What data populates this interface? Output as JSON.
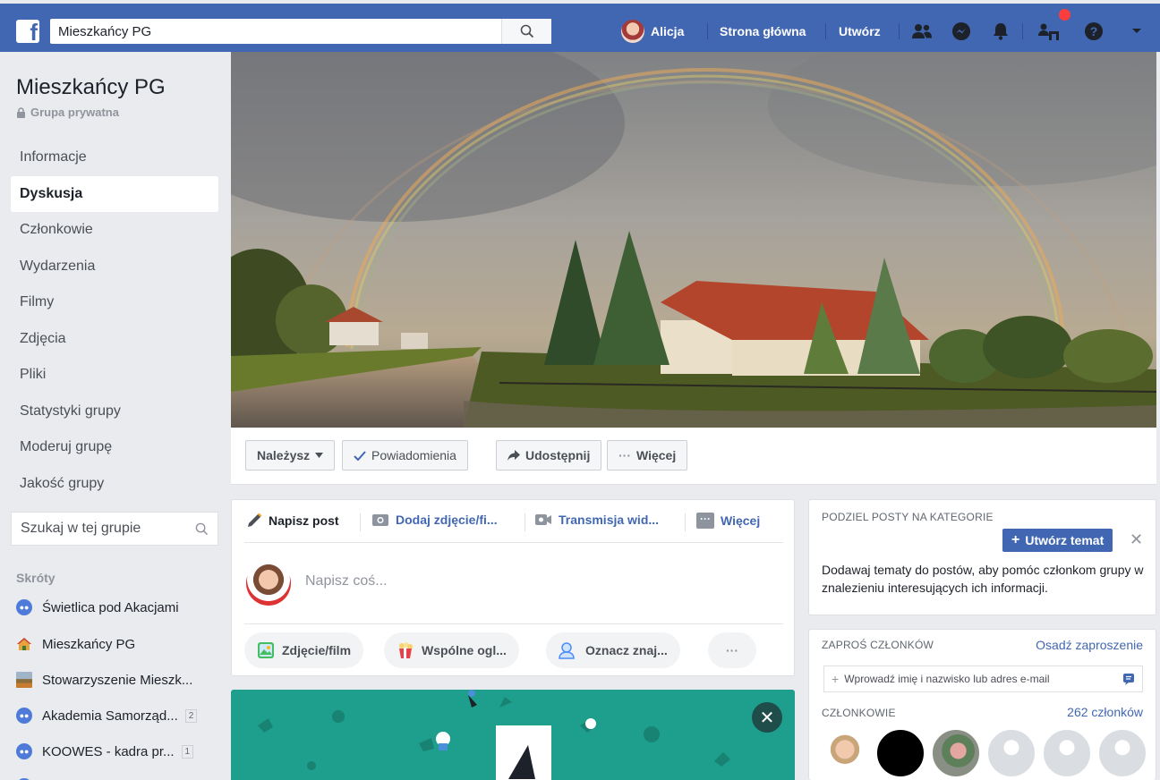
{
  "topbar": {
    "search_value": "Mieszkańcy PG",
    "user_name": "Alicja",
    "home_label": "Strona główna",
    "create_label": "Utwórz"
  },
  "group": {
    "title": "Mieszkańcy PG",
    "privacy": "Grupa prywatna"
  },
  "sidebar": {
    "items": [
      {
        "label": "Informacje"
      },
      {
        "label": "Dyskusja"
      },
      {
        "label": "Członkowie"
      },
      {
        "label": "Wydarzenia"
      },
      {
        "label": "Filmy"
      },
      {
        "label": "Zdjęcia"
      },
      {
        "label": "Pliki"
      },
      {
        "label": "Statystyki grupy"
      },
      {
        "label": "Moderuj grupę"
      },
      {
        "label": "Jakość grupy"
      }
    ],
    "search_placeholder": "Szukaj w tej grupie",
    "shortcuts_heading": "Skróty",
    "shortcuts": [
      {
        "label": "Świetlica pod Akacjami",
        "badge": ""
      },
      {
        "label": "Mieszkańcy PG",
        "badge": ""
      },
      {
        "label": "Stowarzyszenie Mieszk...",
        "badge": ""
      },
      {
        "label": "Akademia Samorząd...",
        "badge": "2"
      },
      {
        "label": "KOOWES - kadra pr...",
        "badge": "1"
      }
    ]
  },
  "cover_actions": {
    "member": "Należysz",
    "notifications": "Powiadomienia",
    "share": "Udostępnij",
    "more": "Więcej"
  },
  "composer": {
    "tabs": [
      "Napisz post",
      "Dodaj zdjęcie/fi...",
      "Transmisja wid...",
      "Więcej"
    ],
    "placeholder": "Napisz coś...",
    "actions": [
      "Zdjęcie/film",
      "Wspólne ogl...",
      "Oznacz znaj..."
    ],
    "more_dots": "···"
  },
  "topics_card": {
    "heading": "PODZIEL POSTY NA KATEGORIE",
    "button": "Utwórz temat",
    "text": "Dodawaj tematy do postów, aby pomóc członkom grupy w znalezieniu interesujących ich informacji."
  },
  "invite_card": {
    "heading": "ZAPROŚ CZŁONKÓW",
    "embed_link": "Osadź zaproszenie",
    "input_placeholder": "Wprowadź imię i nazwisko lub adres e-mail",
    "members_heading": "CZŁONKOWIE",
    "members_count": "262 członków"
  },
  "colors": {
    "brand_blue": "#4267b2",
    "notification_red": "#fa3e3e",
    "promo_teal": "#1e9e8c"
  }
}
